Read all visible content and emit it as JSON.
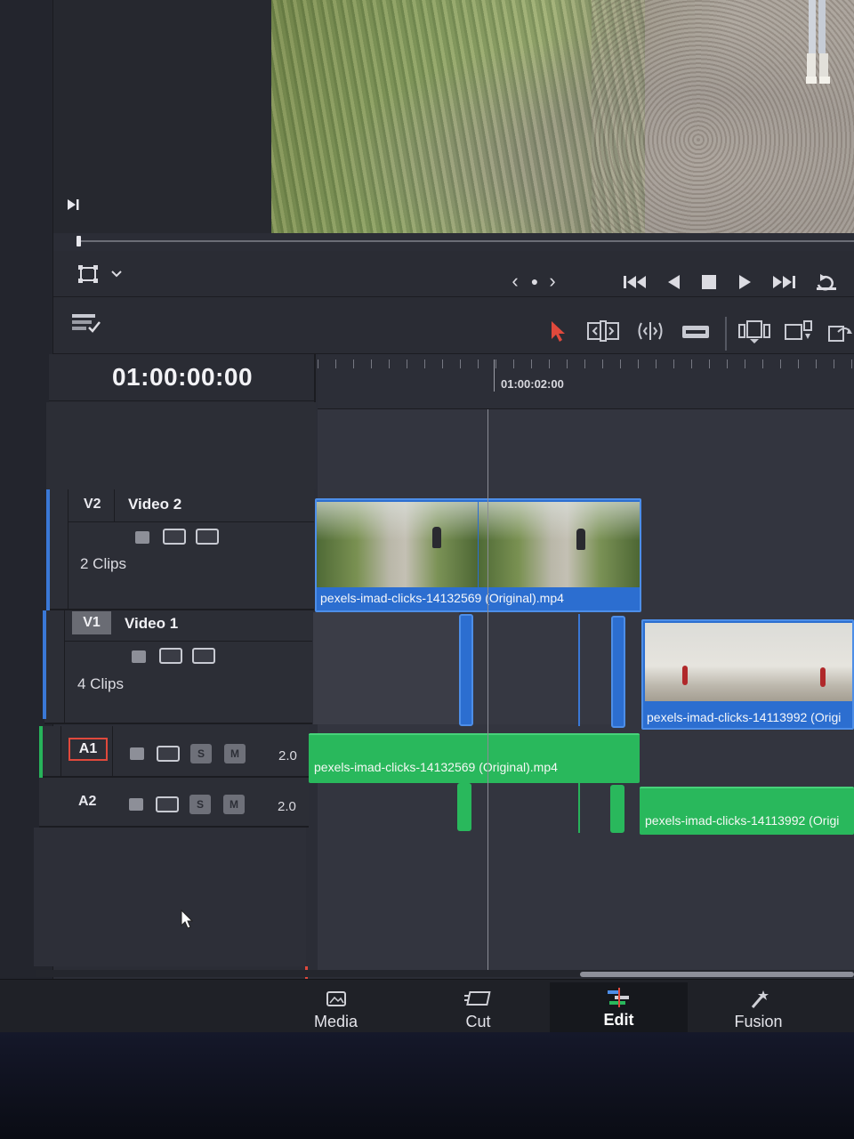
{
  "viewer": {
    "timecode": "01:00:00:00"
  },
  "ruler": {
    "label": "01:00:02:00"
  },
  "transport": {
    "jog_prev": "‹",
    "jog_dot": "●",
    "jog_next": "›",
    "skip_start": "⏮",
    "step_back": "◀",
    "stop": "■",
    "play": "▶",
    "skip_end": "⏭",
    "loop": "↻"
  },
  "tracks": {
    "v2": {
      "id": "V2",
      "name": "Video 2",
      "clips": "2 Clips"
    },
    "v1": {
      "id": "V1",
      "name": "Video 1",
      "clips": "4 Clips"
    },
    "a1": {
      "id": "A1",
      "volume": "2.0",
      "solo": "S",
      "mute": "M"
    },
    "a2": {
      "id": "A2",
      "volume": "2.0",
      "solo": "S",
      "mute": "M"
    }
  },
  "clips": {
    "v2_clip": "pexels-imad-clicks-14132569 (Original).mp4",
    "v1_clip_right": "pexels-imad-clicks-14113992 (Origi",
    "a1_clip": "pexels-imad-clicks-14132569 (Original).mp4",
    "a2_clip_right": "pexels-imad-clicks-14113992 (Origi"
  },
  "page_tabs": [
    {
      "label": "Media",
      "icon": "media-icon",
      "active": false
    },
    {
      "label": "Cut",
      "icon": "cut-icon",
      "active": false
    },
    {
      "label": "Edit",
      "icon": "edit-icon",
      "active": true
    },
    {
      "label": "Fusion",
      "icon": "fusion-icon",
      "active": false
    }
  ],
  "colors": {
    "video_clip": "#2c6ed0",
    "audio_clip": "#29b85c",
    "accent_red": "#e0493c"
  }
}
